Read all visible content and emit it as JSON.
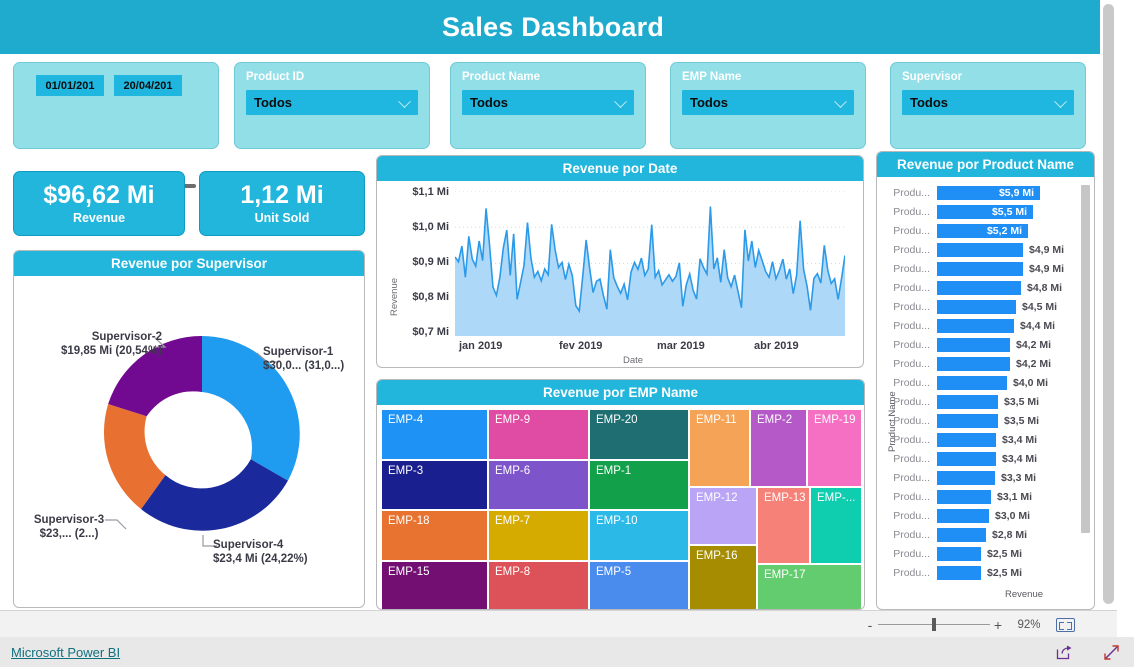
{
  "header": {
    "title": "Sales Dashboard",
    "bg_color": "#1fabcd"
  },
  "slicers": {
    "date": {
      "name": "date-range-slicer",
      "start": "01/01/201",
      "end": "20/04/201"
    },
    "items": [
      {
        "label": "Product ID",
        "value": "Todos",
        "icon": "chevron-down-icon"
      },
      {
        "label": "Product Name",
        "value": "Todos",
        "icon": "chevron-down-icon"
      },
      {
        "label": "EMP Name",
        "value": "Todos",
        "icon": "chevron-down-icon"
      },
      {
        "label": "Supervisor",
        "value": "Todos",
        "icon": "chevron-down-icon"
      }
    ]
  },
  "kpis": [
    {
      "value": "$96,62 Mi",
      "label": "Revenue"
    },
    {
      "value": "1,12 Mi",
      "label": "Unit Sold"
    }
  ],
  "visuals": {
    "donut_title": "Revenue por Supervisor",
    "line_title": "Revenue por Date",
    "treemap_title": "Revenue por EMP Name",
    "bar_title": "Revenue por Product Name"
  },
  "chart_data": [
    {
      "type": "pie",
      "title": "Revenue por Supervisor",
      "legend": "none",
      "categories": [
        "Supervisor-1",
        "Supervisor-2",
        "Supervisor-3",
        "Supervisor-4"
      ],
      "values": [
        30.0,
        19.85,
        23.0,
        23.4
      ],
      "percents": [
        31.0,
        20.54,
        24.0,
        24.22
      ],
      "labels": [
        "Supervisor-1\n$30,0... (31,0...)",
        "Supervisor-2\n$19,85 Mi (20,54%)",
        "Supervisor-3\n$23,... (2...)",
        "Supervisor-4\n$23,4 Mi (24,22%)"
      ],
      "label_lines": [
        [
          "Supervisor-1",
          "$30,0... (31,0...)"
        ],
        [
          "Supervisor-2",
          "$19,85 Mi (20,54%)"
        ],
        [
          "Supervisor-3",
          "$23,... (2...)"
        ],
        [
          "Supervisor-4",
          "$23,4 Mi (24,22%)"
        ]
      ],
      "colors": [
        "#1f9bf0",
        "#720a91",
        "#e87030",
        "#1a2a9c"
      ]
    },
    {
      "type": "area",
      "title": "Revenue por Date",
      "xlabel": "Date",
      "ylabel": "Revenue",
      "ytick_labels": [
        "$1,1 Mi",
        "$1,0 Mi",
        "$0,9 Mi",
        "$0,8 Mi",
        "$0,7 Mi"
      ],
      "ytick_values": [
        1.1,
        1.0,
        0.9,
        0.8,
        0.7
      ],
      "ylim": [
        0.7,
        1.1
      ],
      "xtick_labels": [
        "jan 2019",
        "fev 2019",
        "mar 2019",
        "abr 2019"
      ],
      "grid": true,
      "line_color": "#2b9ae8",
      "fill_color": "#aed8f7",
      "values": [
        0.918,
        0.905,
        0.948,
        0.862,
        0.975,
        0.912,
        0.893,
        0.962,
        0.908,
        1.052,
        0.952,
        0.835,
        0.812,
        0.862,
        0.943,
        0.992,
        0.867,
        0.982,
        0.801,
        0.848,
        0.895,
        1.013,
        0.915,
        0.862,
        0.878,
        0.852,
        0.885,
        0.869,
        1.008,
        0.938,
        0.889,
        0.903,
        0.856,
        0.898,
        0.866,
        0.784,
        0.769,
        0.864,
        0.965,
        0.888,
        0.82,
        0.851,
        0.857,
        0.812,
        0.774,
        0.938,
        0.861,
        0.837,
        0.818,
        0.843,
        0.8,
        0.876,
        0.903,
        0.884,
        0.915,
        0.867,
        0.885,
        1.007,
        0.862,
        0.88,
        0.841,
        0.855,
        0.869,
        0.851,
        0.864,
        0.902,
        0.782,
        0.841,
        0.871,
        0.826,
        0.802,
        0.913,
        0.889,
        0.871,
        1.057,
        0.885,
        0.916,
        0.848,
        0.938,
        0.861,
        0.836,
        0.868,
        0.823,
        0.778,
        0.993,
        0.907,
        0.962,
        0.889,
        0.936,
        0.908,
        0.878,
        0.862,
        0.905,
        0.858,
        0.881,
        0.912,
        0.857,
        0.885,
        0.817,
        0.869,
        1.018,
        0.884,
        0.838,
        0.771,
        0.859,
        0.872,
        0.846,
        0.95,
        0.882,
        0.845,
        0.858,
        0.801,
        0.859,
        0.922
      ]
    },
    {
      "type": "treemap",
      "title": "Revenue por EMP Name",
      "items": [
        {
          "label": "EMP-4",
          "color": "#1f93f5"
        },
        {
          "label": "EMP-9",
          "color": "#e04ba3"
        },
        {
          "label": "EMP-20",
          "color": "#1f6f72"
        },
        {
          "label": "EMP-11",
          "color": "#f5a356"
        },
        {
          "label": "EMP-2",
          "color": "#b558c8"
        },
        {
          "label": "EMP-19",
          "color": "#f56fc3"
        },
        {
          "label": "EMP-3",
          "color": "#1a1f8f"
        },
        {
          "label": "EMP-6",
          "color": "#7d54c9"
        },
        {
          "label": "EMP-1",
          "color": "#13a04a"
        },
        {
          "label": "EMP-12",
          "color": "#b9a4f5"
        },
        {
          "label": "EMP-13",
          "color": "#f58178"
        },
        {
          "label": "EMP-...",
          "color": "#0fceb0"
        },
        {
          "label": "EMP-18",
          "color": "#e87330"
        },
        {
          "label": "EMP-7",
          "color": "#d6ab00"
        },
        {
          "label": "EMP-10",
          "color": "#2bb9e8"
        },
        {
          "label": "EMP-16",
          "color": "#a58c00"
        },
        {
          "label": "EMP-15",
          "color": "#730f73"
        },
        {
          "label": "EMP-8",
          "color": "#dd5258"
        },
        {
          "label": "EMP-5",
          "color": "#4a8ced"
        },
        {
          "label": "EMP-17",
          "color": "#62cc6e"
        }
      ]
    },
    {
      "type": "bar",
      "title": "Revenue por Product Name",
      "xlabel": "Revenue",
      "ylabel": "Product Name",
      "bar_color": "#1f8ff5",
      "category_label": "Produ...",
      "categories": [
        "Produ...",
        "Produ...",
        "Produ...",
        "Produ...",
        "Produ...",
        "Produ...",
        "Produ...",
        "Produ...",
        "Produ...",
        "Produ...",
        "Produ...",
        "Produ...",
        "Produ...",
        "Produ...",
        "Produ...",
        "Produ...",
        "Produ...",
        "Produ...",
        "Produ...",
        "Produ...",
        "Produ..."
      ],
      "values": [
        5.9,
        5.5,
        5.2,
        4.9,
        4.9,
        4.8,
        4.5,
        4.4,
        4.2,
        4.2,
        4.0,
        3.5,
        3.5,
        3.4,
        3.4,
        3.3,
        3.1,
        3.0,
        2.8,
        2.5,
        2.5
      ],
      "value_labels": [
        "$5,9 Mi",
        "$5,5 Mi",
        "$5,2 Mi",
        "$4,9 Mi",
        "$4,9 Mi",
        "$4,8 Mi",
        "$4,5 Mi",
        "$4,4 Mi",
        "$4,2 Mi",
        "$4,2 Mi",
        "$4,0 Mi",
        "$3,5 Mi",
        "$3,5 Mi",
        "$3,4 Mi",
        "$3,4 Mi",
        "$3,3 Mi",
        "$3,1 Mi",
        "$3,0 Mi",
        "$2,8 Mi",
        "$2,5 Mi",
        "$2,5 Mi"
      ],
      "labels_inside": [
        true,
        true,
        true,
        false,
        false,
        false,
        false,
        false,
        false,
        false,
        false,
        false,
        false,
        false,
        false,
        false,
        false,
        false,
        false,
        false,
        false
      ]
    }
  ],
  "statusbar": {
    "zoom_minus": "-",
    "zoom_plus": "+",
    "zoom_percent": "92%",
    "fit_icon": "fit-to-page-icon"
  },
  "footer": {
    "brand": "Microsoft Power BI",
    "share_icon": "share-icon",
    "fullscreen_icon": "fullscreen-icon"
  }
}
